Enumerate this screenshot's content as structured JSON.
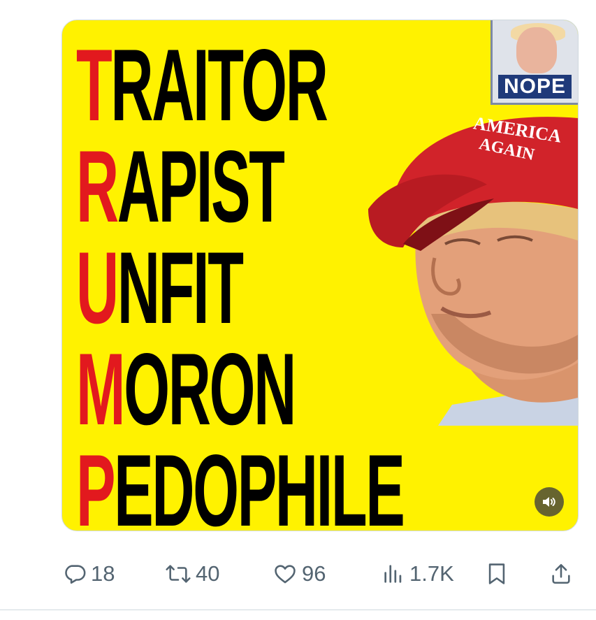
{
  "tweet": {
    "media": {
      "headline_lines": [
        {
          "first": "T",
          "rest": "RAITOR"
        },
        {
          "first": "R",
          "rest": "APIST"
        },
        {
          "first": "U",
          "rest": "NFIT"
        },
        {
          "first": "M",
          "rest": "ORON"
        },
        {
          "first": "P",
          "rest": "EDOPHILE"
        }
      ],
      "poster_label": "NOPE",
      "cap_text": [
        "AMERICA",
        "AGAIN"
      ],
      "colors": {
        "background": "#fff200",
        "accent_letters": "#e2191e",
        "headline_text": "#000000",
        "cap": "#d1232a"
      },
      "volume_icon": "speaker-volume-icon"
    },
    "actions": {
      "reply": {
        "icon": "reply-icon",
        "count": "18"
      },
      "retweet": {
        "icon": "retweet-icon",
        "count": "40"
      },
      "like": {
        "icon": "heart-icon",
        "count": "96"
      },
      "views": {
        "icon": "views-chart-icon",
        "count": "1.7K"
      },
      "bookmark": {
        "icon": "bookmark-icon"
      },
      "share": {
        "icon": "share-icon"
      }
    },
    "colors": {
      "action_gray": "#536471",
      "divider": "#cfd9de"
    }
  }
}
